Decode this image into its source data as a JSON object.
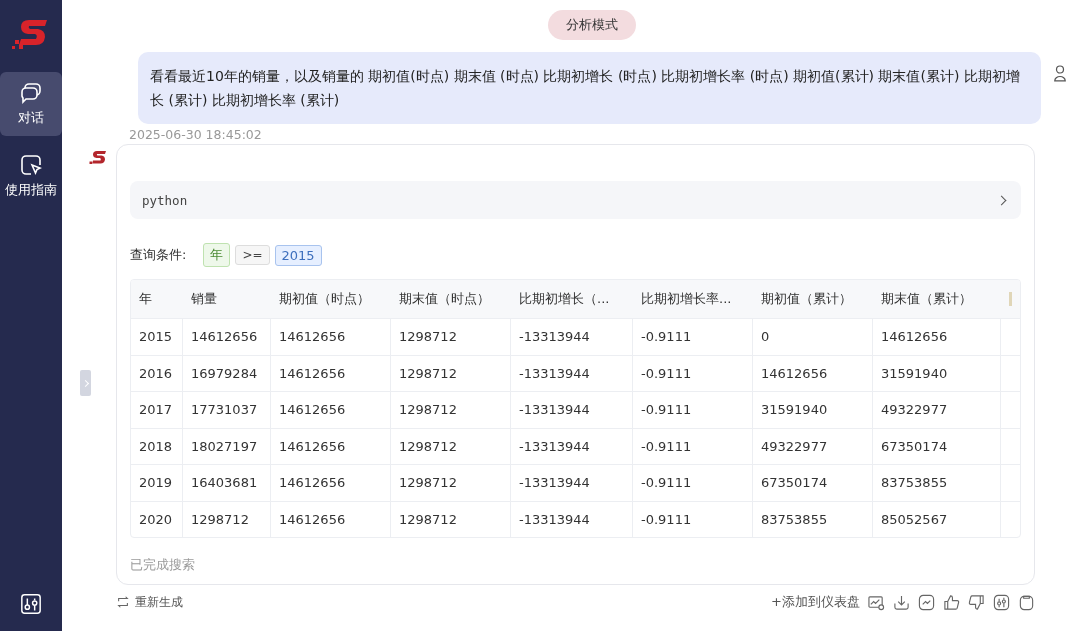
{
  "sidebar": {
    "items": [
      {
        "label": "对话",
        "kind": "chat",
        "selected": true
      },
      {
        "label": "使用指南",
        "kind": "guide",
        "selected": false
      }
    ]
  },
  "mode_badge": "分析模式",
  "user_message": "看看最近10年的销量，以及销量的 期初值(时点) 期末值 (时点) 比期初增长 (时点) 比期初增长率 (时点) 期初值(累计) 期末值(累计) 比期初增长 (累计) 比期初增长率 (累计)",
  "timestamp": "2025-06-30 18:45:02",
  "code_block": {
    "language": "python",
    "expanded": false
  },
  "query": {
    "label": "查询条件:",
    "tags": [
      {
        "text": "年",
        "kind": "field"
      },
      {
        "text": ">=",
        "kind": "operator"
      },
      {
        "text": "2015",
        "kind": "value"
      }
    ]
  },
  "table": {
    "columns": [
      "年",
      "销量",
      "期初值（时点）",
      "期末值（时点）",
      "比期初增长（...",
      "比期初增长率...",
      "期初值（累计）",
      "期末值（累计）"
    ],
    "rows": [
      [
        "2015",
        "14612656",
        "14612656",
        "1298712",
        "-13313944",
        "-0.9111",
        "0",
        "14612656"
      ],
      [
        "2016",
        "16979284",
        "14612656",
        "1298712",
        "-13313944",
        "-0.9111",
        "14612656",
        "31591940"
      ],
      [
        "2017",
        "17731037",
        "14612656",
        "1298712",
        "-13313944",
        "-0.9111",
        "31591940",
        "49322977"
      ],
      [
        "2018",
        "18027197",
        "14612656",
        "1298712",
        "-13313944",
        "-0.9111",
        "49322977",
        "67350174"
      ],
      [
        "2019",
        "16403681",
        "14612656",
        "1298712",
        "-13313944",
        "-0.9111",
        "67350174",
        "83753855"
      ],
      [
        "2020",
        "1298712",
        "14612656",
        "1298712",
        "-13313944",
        "-0.9111",
        "83753855",
        "85052567"
      ]
    ]
  },
  "status": "已完成搜索",
  "regenerate": "重新生成",
  "add_dashboard": "+添加到仪表盘"
}
